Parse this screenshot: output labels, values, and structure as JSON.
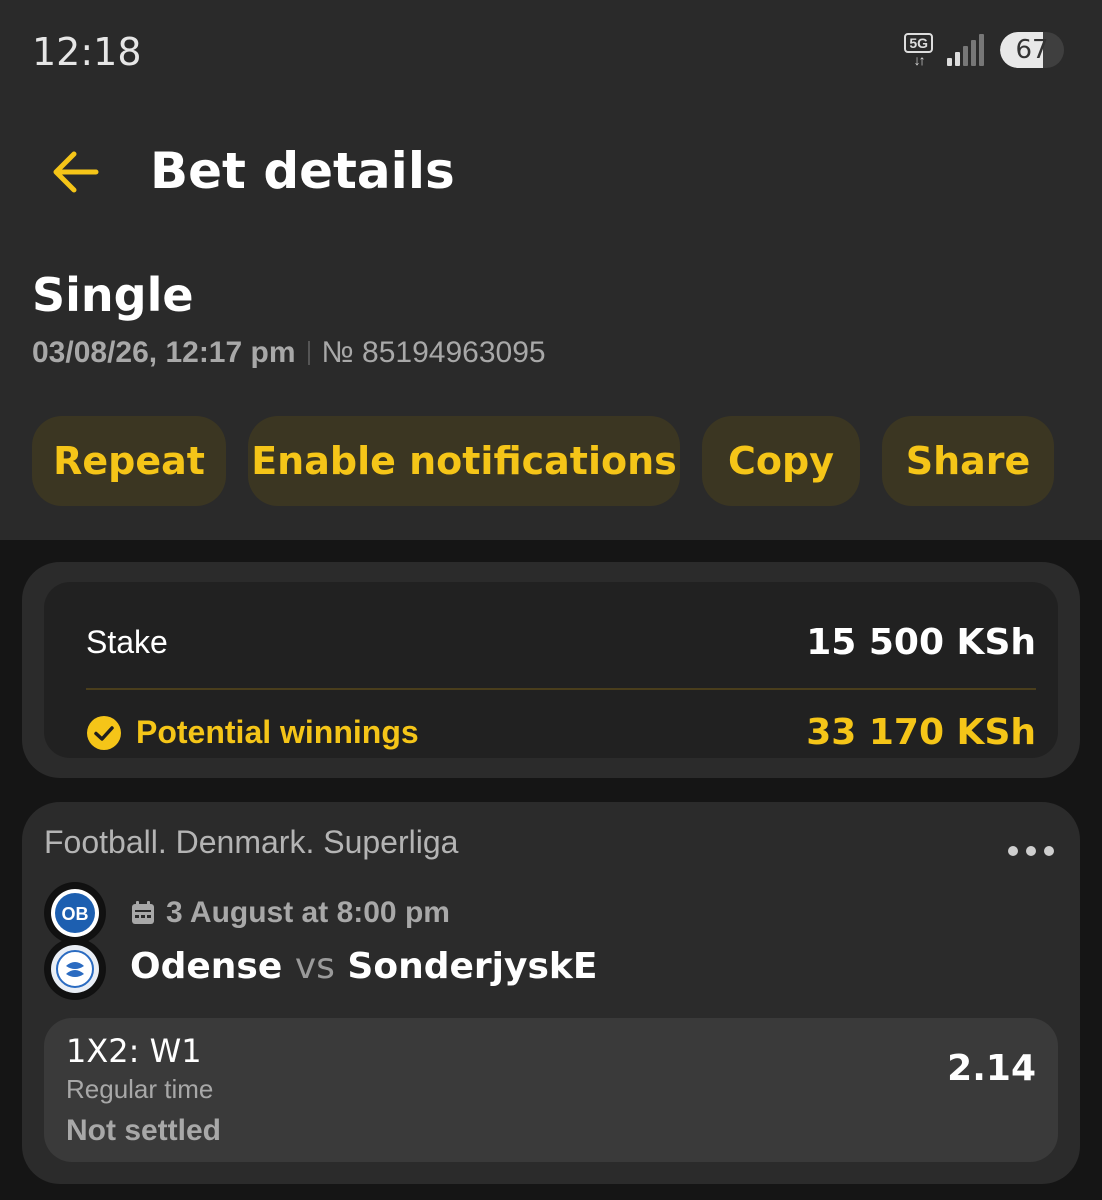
{
  "status_bar": {
    "time": "12:18",
    "network": "5G",
    "battery": 67,
    "battery_label": "67"
  },
  "header": {
    "title": "Bet details",
    "back_icon": "arrow-left-icon"
  },
  "bet": {
    "type": "Single",
    "datetime": "03/08/26, 12:17 pm",
    "number": "№ 85194963095"
  },
  "actions": {
    "repeat": "Repeat",
    "enable_notifications": "Enable notifications",
    "copy": "Copy",
    "share": "Share"
  },
  "summary": {
    "stake_label": "Stake",
    "stake_value": "15 500 KSh",
    "winnings_label": "Potential winnings",
    "winnings_value": "33 170 KSh"
  },
  "event": {
    "league": "Football. Denmark. Superliga",
    "date": "3 August at 8:00 pm",
    "home_team": "Odense",
    "vs": "vs",
    "away_team": "SonderjyskE",
    "home_logo_text": "OB",
    "market": "1X2: W1",
    "period": "Regular time",
    "status": "Not settled",
    "odds": "2.14"
  },
  "colors": {
    "accent": "#f5c518",
    "pill_bg": "#3b3622",
    "card_bg": "#2b2b2b",
    "header_bg": "#2a2a2a",
    "page_bg": "#151515"
  }
}
